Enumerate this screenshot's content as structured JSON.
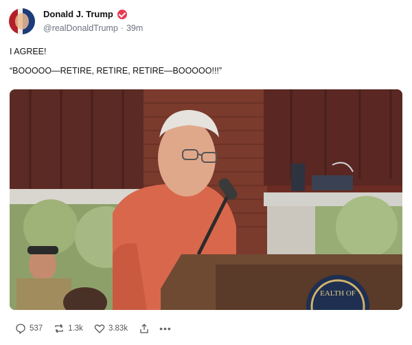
{
  "post": {
    "author_name": "Donald J. Trump",
    "handle": "@realDonaldTrump",
    "separator": "·",
    "time": "39m",
    "text_line1": "I AGREE!",
    "text_line2": "“BOOOOO—RETIRE, RETIRE, RETIRE—BOOOOO!!!”"
  },
  "image": {
    "seal_text": "EALTH OF"
  },
  "actions": {
    "replies": "537",
    "reposts": "1.3k",
    "likes": "3.83k"
  },
  "icons": {
    "avatar": "profile-photo",
    "verified": "verified-badge-icon",
    "reply": "comment-icon",
    "repost": "repost-icon",
    "like": "heart-icon",
    "share": "share-icon",
    "more": "more-icon"
  },
  "colors": {
    "verified": "#e63b54",
    "text": "#0f1419",
    "muted": "#6b7280"
  }
}
